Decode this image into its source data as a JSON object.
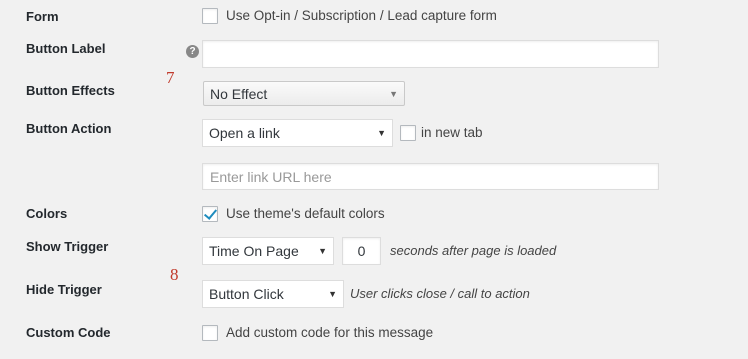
{
  "rows": {
    "form": {
      "label": "Form",
      "checkbox_label": "Use Opt-in / Subscription / Lead capture form",
      "checked": false
    },
    "button_label": {
      "label": "Button Label",
      "value": ""
    },
    "button_effects": {
      "label": "Button Effects",
      "selected": "No Effect"
    },
    "button_action": {
      "label": "Button Action",
      "selected": "Open a link",
      "new_tab_label": "in new tab",
      "new_tab_checked": false,
      "url_placeholder": "Enter link URL here"
    },
    "colors": {
      "label": "Colors",
      "checkbox_label": "Use theme's default colors",
      "checked": true
    },
    "show_trigger": {
      "label": "Show Trigger",
      "selected": "Time On Page",
      "seconds": "0",
      "suffix": "seconds after page is loaded"
    },
    "hide_trigger": {
      "label": "Hide Trigger",
      "selected": "Button Click",
      "suffix": "User clicks close / call to action"
    },
    "custom_code": {
      "label": "Custom Code",
      "checkbox_label": "Add custom code for this message",
      "checked": false
    }
  },
  "annotations": {
    "marker_7": "7",
    "marker_8": "8"
  },
  "help_icon": "?",
  "colors": {
    "background": "#f1f1f1",
    "accent": "#1e8cbe",
    "annotation": "#c0392b"
  }
}
